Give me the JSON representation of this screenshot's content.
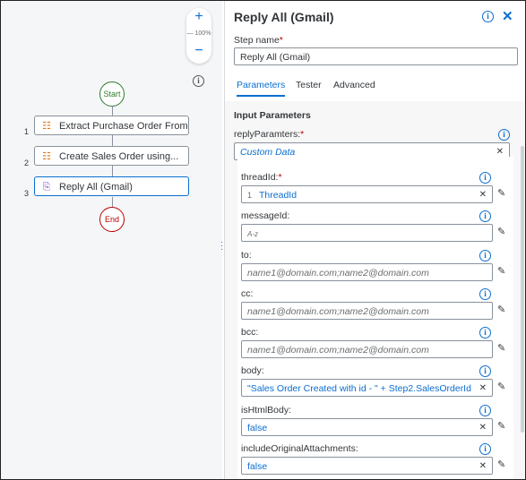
{
  "canvas": {
    "zoom_in": "+",
    "zoom_level": "100%",
    "zoom_out": "−",
    "start_label": "Start",
    "end_label": "End",
    "steps": [
      {
        "num": "1",
        "label": "Extract Purchase Order From..."
      },
      {
        "num": "2",
        "label": "Create Sales Order using..."
      },
      {
        "num": "3",
        "label": "Reply All (Gmail)"
      }
    ]
  },
  "panel": {
    "title": "Reply All (Gmail)",
    "step_name_label": "Step name",
    "step_name_value": "Reply All (Gmail)",
    "tabs": [
      "Parameters",
      "Tester",
      "Advanced"
    ],
    "section_title": "Input Parameters",
    "reply_params_label": "replyParamters:",
    "reply_params_value": "Custom Data",
    "fields": {
      "threadId": {
        "label": "threadId:",
        "chip_num": "1",
        "value": "ThreadId"
      },
      "messageId": {
        "label": "messageId:",
        "value": "A-z"
      },
      "to": {
        "label": "to:",
        "placeholder": "name1@domain.com;name2@domain.com"
      },
      "cc": {
        "label": "cc:",
        "placeholder": "name1@domain.com;name2@domain.com"
      },
      "bcc": {
        "label": "bcc:",
        "placeholder": "name1@domain.com;name2@domain.com"
      },
      "body": {
        "label": "body:",
        "value": "\"Sales Order Created with id - \" + Step2.SalesOrderId"
      },
      "isHtmlBody": {
        "label": "isHtmlBody:",
        "value": "false"
      },
      "includeOriginalAttachments": {
        "label": "includeOriginalAttachments:",
        "value": "false"
      }
    }
  }
}
